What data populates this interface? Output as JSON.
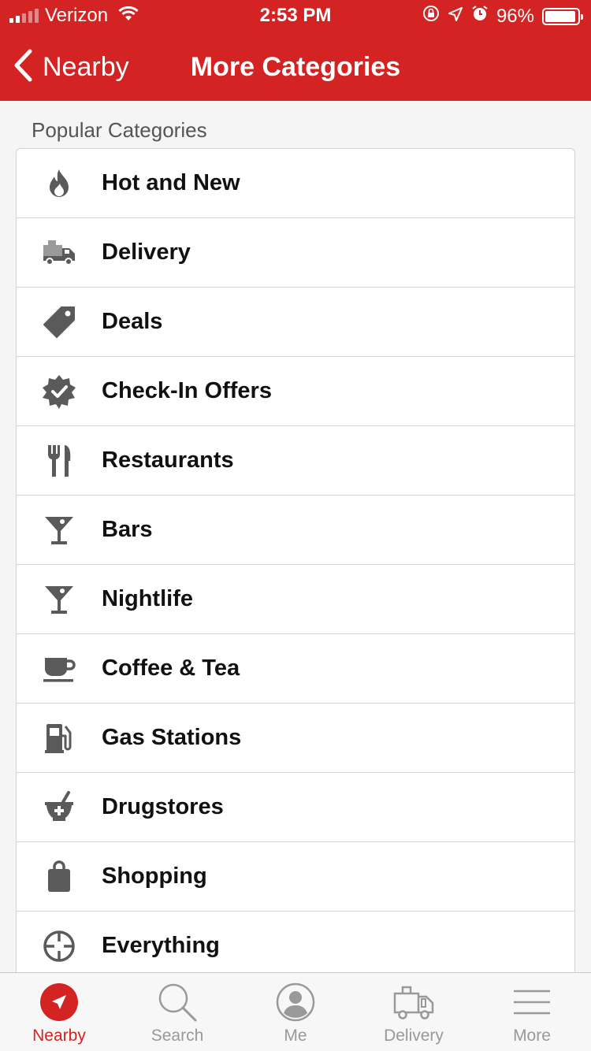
{
  "status_bar": {
    "carrier": "Verizon",
    "time": "2:53 PM",
    "battery": "96%",
    "battery_level": 0.96
  },
  "nav": {
    "back_label": "Nearby",
    "title": "More Categories"
  },
  "section": {
    "label": "Popular Categories"
  },
  "categories": [
    {
      "label": "Hot and New",
      "icon": "flame-icon"
    },
    {
      "label": "Delivery",
      "icon": "delivery-truck-icon"
    },
    {
      "label": "Deals",
      "icon": "tag-icon"
    },
    {
      "label": "Check-In Offers",
      "icon": "verified-badge-icon"
    },
    {
      "label": "Restaurants",
      "icon": "fork-knife-icon"
    },
    {
      "label": "Bars",
      "icon": "cocktail-icon"
    },
    {
      "label": "Nightlife",
      "icon": "cocktail-icon"
    },
    {
      "label": "Coffee & Tea",
      "icon": "coffee-cup-icon"
    },
    {
      "label": "Gas Stations",
      "icon": "gas-pump-icon"
    },
    {
      "label": "Drugstores",
      "icon": "mortar-pestle-icon"
    },
    {
      "label": "Shopping",
      "icon": "shopping-bag-icon"
    },
    {
      "label": "Everything",
      "icon": "crosshair-icon"
    }
  ],
  "tabbar": {
    "tabs": [
      {
        "label": "Nearby",
        "icon": "location-arrow-icon",
        "active": true
      },
      {
        "label": "Search",
        "icon": "search-icon",
        "active": false
      },
      {
        "label": "Me",
        "icon": "profile-icon",
        "active": false
      },
      {
        "label": "Delivery",
        "icon": "delivery-truck-icon",
        "active": false
      },
      {
        "label": "More",
        "icon": "menu-icon",
        "active": false
      }
    ]
  },
  "colors": {
    "brand_red": "#d32323",
    "icon_gray": "#5a5a5a",
    "inactive_tab": "#999999"
  }
}
